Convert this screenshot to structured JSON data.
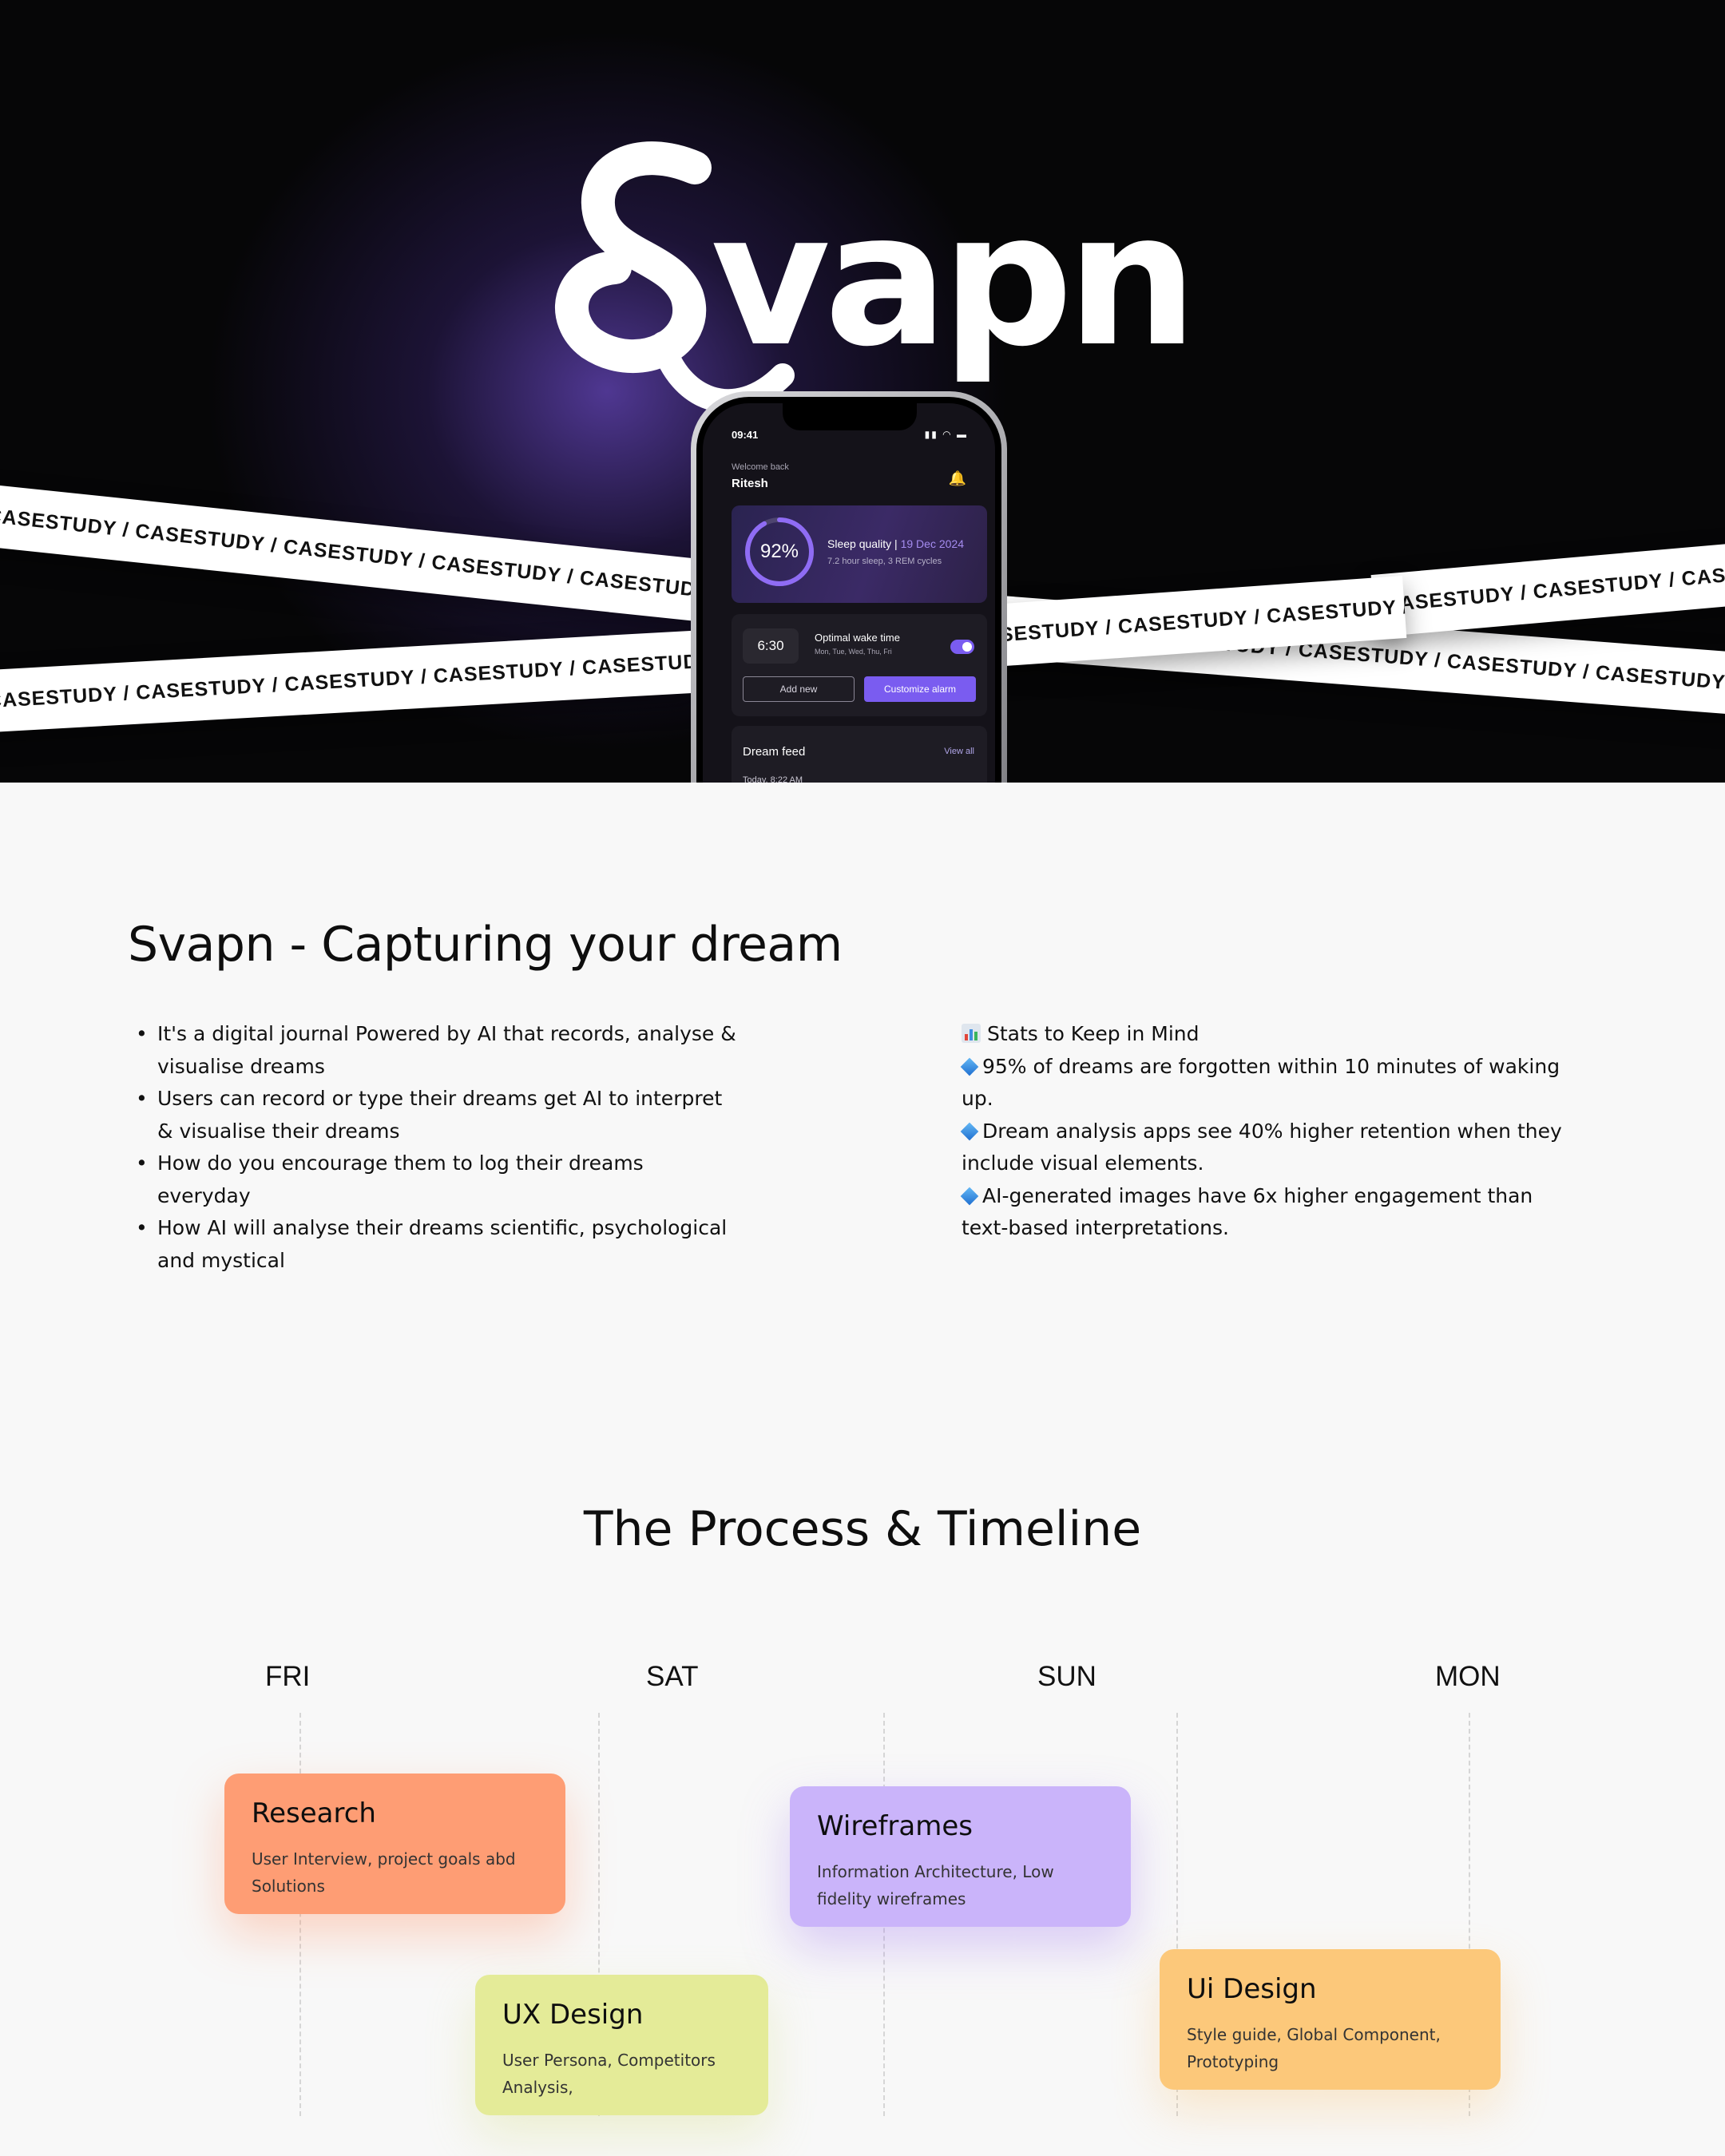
{
  "hero": {
    "logo_text": "Svapn",
    "tape_label": "CASESTUDY",
    "tape_separator": "/",
    "phone": {
      "time": "09:41",
      "welcome": "Welcome back",
      "user_name": "Ritesh",
      "sleep_card": {
        "percent": "92%",
        "percent_value": 0.92,
        "title": "Sleep quality | ",
        "date": "19 Dec 2024",
        "subtitle": "7.2 hour sleep, 3 REM cycles"
      },
      "alarm_card": {
        "time": "6:30",
        "title": "Optimal wake time",
        "days": "Mon, Tue, Wed, Thu, Fri",
        "toggle_on": true,
        "add_label": "Add new",
        "customize_label": "Customize alarm"
      },
      "feed_card": {
        "title": "Dream feed",
        "view_all": "View all",
        "date": "Today, 8:22 AM"
      }
    }
  },
  "intro": {
    "title": "Svapn - Capturing your dream",
    "bullets": [
      "It's a digital journal Powered by AI that records, analyse & visualise dreams",
      "Users can record or type their dreams get AI to interpret & visualise their dreams",
      "How do you encourage them to log their dreams everyday",
      "How AI will analyse their dreams scientific, psychological and mystical"
    ],
    "stats_heading": "Stats to Keep in Mind",
    "stats": [
      "95% of dreams are forgotten within 10 minutes of waking up.",
      "Dream analysis apps see 40% higher retention when they include visual elements.",
      "AI-generated images have 6x higher engagement than text-based interpretations."
    ]
  },
  "process": {
    "title": "The Process & Timeline",
    "days": [
      "FRI",
      "SAT",
      "SUN",
      "MON"
    ],
    "cards": [
      {
        "title": "Research",
        "desc": "User Interview, project goals abd Solutions"
      },
      {
        "title": "UX Design",
        "desc": "User Persona, Competitors Analysis,"
      },
      {
        "title": "Wireframes",
        "desc": "Information Architecture, Low fidelity wireframes"
      },
      {
        "title": "Ui Design",
        "desc": "Style guide, Global Component, Prototyping"
      }
    ]
  },
  "colors": {
    "hero_bg": "#060607",
    "accent_purple": "#7a5cf0",
    "research": "#fe9d74",
    "ux_design": "#e4eb98",
    "wireframes": "#cab4fa",
    "ui_design": "#fcc87a"
  },
  "icons": [
    "bell-icon",
    "signal-icon",
    "wifi-icon",
    "battery-icon",
    "star-icon",
    "bar-chart-icon",
    "diamond-icon"
  ]
}
